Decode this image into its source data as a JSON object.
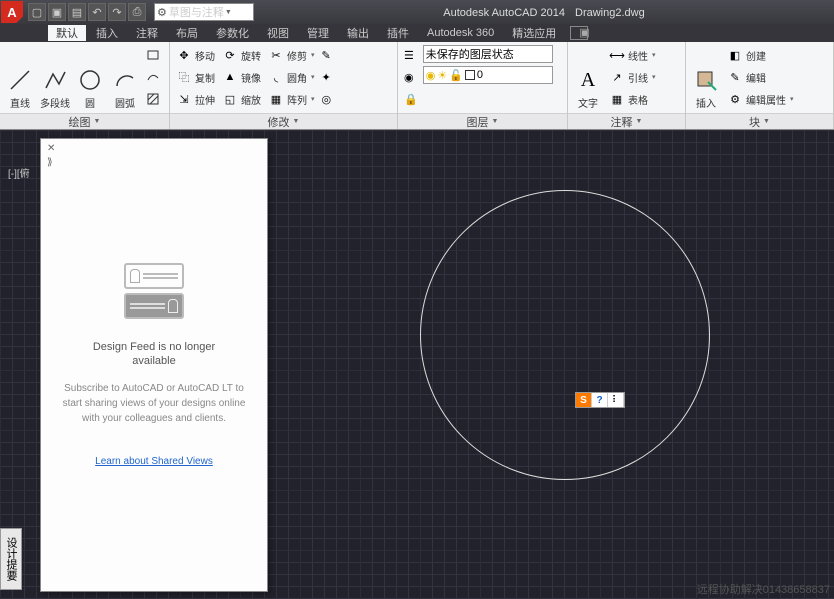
{
  "title": {
    "app": "Autodesk AutoCAD 2014",
    "file": "Drawing2.dwg"
  },
  "workspace": "草图与注释",
  "tabs": {
    "t0": "默认",
    "t1": "插入",
    "t2": "注释",
    "t3": "布局",
    "t4": "参数化",
    "t5": "视图",
    "t6": "管理",
    "t7": "输出",
    "t8": "插件",
    "t9": "Autodesk 360",
    "t10": "精选应用"
  },
  "draw": {
    "line": "直线",
    "pline": "多段线",
    "circle": "圆",
    "arc": "圆弧",
    "title": "绘图"
  },
  "modify": {
    "move": "移动",
    "copy": "复制",
    "stretch": "拉伸",
    "rotate": "旋转",
    "mirror": "镜像",
    "scale": "缩放",
    "trim": "修剪",
    "fillet": "圆角",
    "array": "阵列",
    "title": "修改"
  },
  "layer": {
    "state": "未保存的图层状态",
    "current": "0",
    "title": "图层"
  },
  "annot": {
    "text": "文字",
    "linetype": "线性",
    "leader": "引线",
    "table": "表格",
    "title": "注释"
  },
  "block": {
    "insert": "插入",
    "create": "创建",
    "edit": "编辑",
    "attedit": "编辑属性",
    "title": "块"
  },
  "feed": {
    "h1": "Design Feed is no longer",
    "h2": "available",
    "p": "Subscribe to AutoCAD or AutoCAD LT to start sharing views of your designs online with your colleagues and clients.",
    "link": "Learn about Shared Views"
  },
  "sidetab": "设计提要",
  "vplabel": "[-][俯",
  "footer": "远程协助解决01438658837"
}
